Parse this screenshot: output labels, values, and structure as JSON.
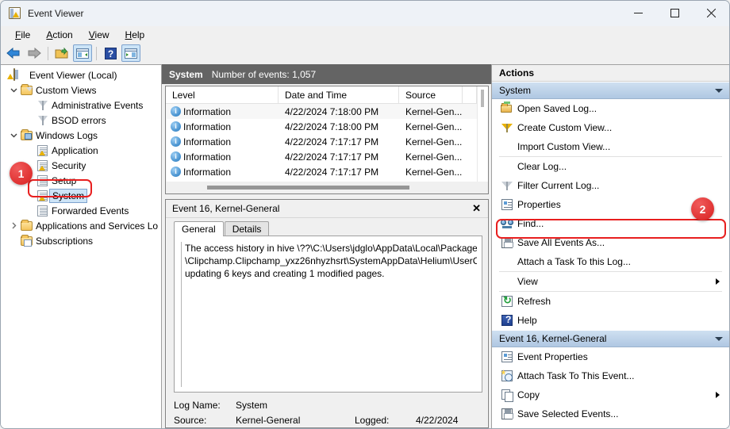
{
  "window": {
    "title": "Event Viewer",
    "icon": "event-viewer-icon",
    "caption_buttons": [
      "minimize",
      "maximize",
      "close"
    ]
  },
  "menubar": {
    "items": [
      {
        "label": "File",
        "accel": "F"
      },
      {
        "label": "Action",
        "accel": "A"
      },
      {
        "label": "View",
        "accel": "V"
      },
      {
        "label": "Help",
        "accel": "H"
      }
    ]
  },
  "toolbar": {
    "buttons": [
      {
        "name": "back-icon",
        "selected": false
      },
      {
        "name": "forward-icon",
        "selected": false
      },
      {
        "name": "up-folder-icon",
        "selected": false
      },
      {
        "name": "show-console-tree-icon",
        "selected": true
      },
      {
        "name": "help-icon",
        "selected": false
      },
      {
        "name": "show-action-pane-icon",
        "selected": true
      }
    ]
  },
  "tree": {
    "items": [
      {
        "label": "Event Viewer (Local)",
        "indent": 0,
        "chevron": "none",
        "icon": "event-viewer-icon",
        "selected": false
      },
      {
        "label": "Custom Views",
        "indent": 1,
        "chevron": "down",
        "icon": "custom-views-folder-icon",
        "selected": false
      },
      {
        "label": "Administrative Events",
        "indent": 2,
        "chevron": "none",
        "icon": "filter-icon",
        "selected": false
      },
      {
        "label": "BSOD errors",
        "indent": 2,
        "chevron": "none",
        "icon": "filter-icon",
        "selected": false
      },
      {
        "label": "Windows Logs",
        "indent": 1,
        "chevron": "down",
        "icon": "windows-logs-folder-icon",
        "selected": false
      },
      {
        "label": "Application",
        "indent": 2,
        "chevron": "none",
        "icon": "log-warning-icon",
        "selected": false
      },
      {
        "label": "Security",
        "indent": 2,
        "chevron": "none",
        "icon": "log-warning-icon",
        "selected": false
      },
      {
        "label": "Setup",
        "indent": 2,
        "chevron": "none",
        "icon": "log-icon",
        "selected": false
      },
      {
        "label": "System",
        "indent": 2,
        "chevron": "none",
        "icon": "log-warning-icon",
        "selected": true
      },
      {
        "label": "Forwarded Events",
        "indent": 2,
        "chevron": "none",
        "icon": "log-icon",
        "selected": false
      },
      {
        "label": "Applications and Services Lo",
        "indent": 1,
        "chevron": "right",
        "icon": "folder-icon",
        "selected": false
      },
      {
        "label": "Subscriptions",
        "indent": 1,
        "chevron": "none",
        "icon": "subscriptions-folder-icon",
        "selected": false
      }
    ]
  },
  "list": {
    "header_title": "System",
    "header_count": "Number of events: 1,057",
    "columns": [
      "Level",
      "Date and Time",
      "Source",
      ""
    ],
    "rows": [
      {
        "level": "Information",
        "datetime": "4/22/2024 7:18:00 PM",
        "source": "Kernel-Gen...",
        "extra": ""
      },
      {
        "level": "Information",
        "datetime": "4/22/2024 7:18:00 PM",
        "source": "Kernel-Gen...",
        "extra": ""
      },
      {
        "level": "Information",
        "datetime": "4/22/2024 7:17:17 PM",
        "source": "Kernel-Gen...",
        "extra": ""
      },
      {
        "level": "Information",
        "datetime": "4/22/2024 7:17:17 PM",
        "source": "Kernel-Gen...",
        "extra": ""
      },
      {
        "level": "Information",
        "datetime": "4/22/2024 7:17:17 PM",
        "source": "Kernel-Gen...",
        "extra": ""
      }
    ]
  },
  "details": {
    "title": "Event 16, Kernel-General",
    "close_glyph": "✕",
    "tabs": [
      {
        "label": "General",
        "active": true
      },
      {
        "label": "Details",
        "active": false
      }
    ],
    "description": "The access history in hive \\??\\C:\\Users\\jdglo\\AppData\\Local\\Packages\n\\Clipchamp.Clipchamp_yxz26nhyzhsrt\\SystemAppData\\Helium\\UserCl\nupdating 6 keys and creating 1 modified pages.",
    "fields": {
      "log_name_label": "Log Name:",
      "log_name_value": "System",
      "source_label": "Source:",
      "source_value": "Kernel-General",
      "logged_label": "Logged:",
      "logged_value": "4/22/2024"
    }
  },
  "actions": {
    "pane_title": "Actions",
    "groups": [
      {
        "title": "System",
        "collapse_glyph": "triangle-up",
        "items": [
          {
            "label": "Open Saved Log...",
            "icon": "open-saved-log-icon",
            "submenu": false,
            "sep_after": false
          },
          {
            "label": "Create Custom View...",
            "icon": "create-custom-view-icon",
            "submenu": false,
            "sep_after": false
          },
          {
            "label": "Import Custom View...",
            "icon": "none",
            "submenu": false,
            "sep_after": true
          },
          {
            "label": "Clear Log...",
            "icon": "none",
            "submenu": false,
            "sep_after": false
          },
          {
            "label": "Filter Current Log...",
            "icon": "filter-icon",
            "submenu": false,
            "sep_after": false
          },
          {
            "label": "Properties",
            "icon": "properties-icon",
            "submenu": false,
            "sep_after": false
          },
          {
            "label": "Find...",
            "icon": "find-icon",
            "submenu": false,
            "sep_after": false
          },
          {
            "label": "Save All Events As...",
            "icon": "save-icon",
            "submenu": false,
            "sep_after": false
          },
          {
            "label": "Attach a Task To this Log...",
            "icon": "none",
            "submenu": false,
            "sep_after": true
          },
          {
            "label": "View",
            "icon": "none",
            "submenu": true,
            "sep_after": true
          },
          {
            "label": "Refresh",
            "icon": "refresh-icon",
            "submenu": false,
            "sep_after": false
          },
          {
            "label": "Help",
            "icon": "help-icon",
            "submenu": false,
            "sep_after": false
          }
        ]
      },
      {
        "title": "Event 16, Kernel-General",
        "collapse_glyph": "triangle-up",
        "items": [
          {
            "label": "Event Properties",
            "icon": "properties-icon",
            "submenu": false,
            "sep_after": false
          },
          {
            "label": "Attach Task To This Event...",
            "icon": "attach-task-icon",
            "submenu": false,
            "sep_after": false
          },
          {
            "label": "Copy",
            "icon": "copy-icon",
            "submenu": true,
            "sep_after": false
          },
          {
            "label": "Save Selected Events...",
            "icon": "save-icon",
            "submenu": false,
            "sep_after": false
          }
        ]
      }
    ]
  },
  "annotations": {
    "accent_color": "#e81f1f",
    "badges": [
      {
        "number": "1",
        "target": "tree-item-system"
      },
      {
        "number": "2",
        "target": "action-find"
      }
    ]
  }
}
